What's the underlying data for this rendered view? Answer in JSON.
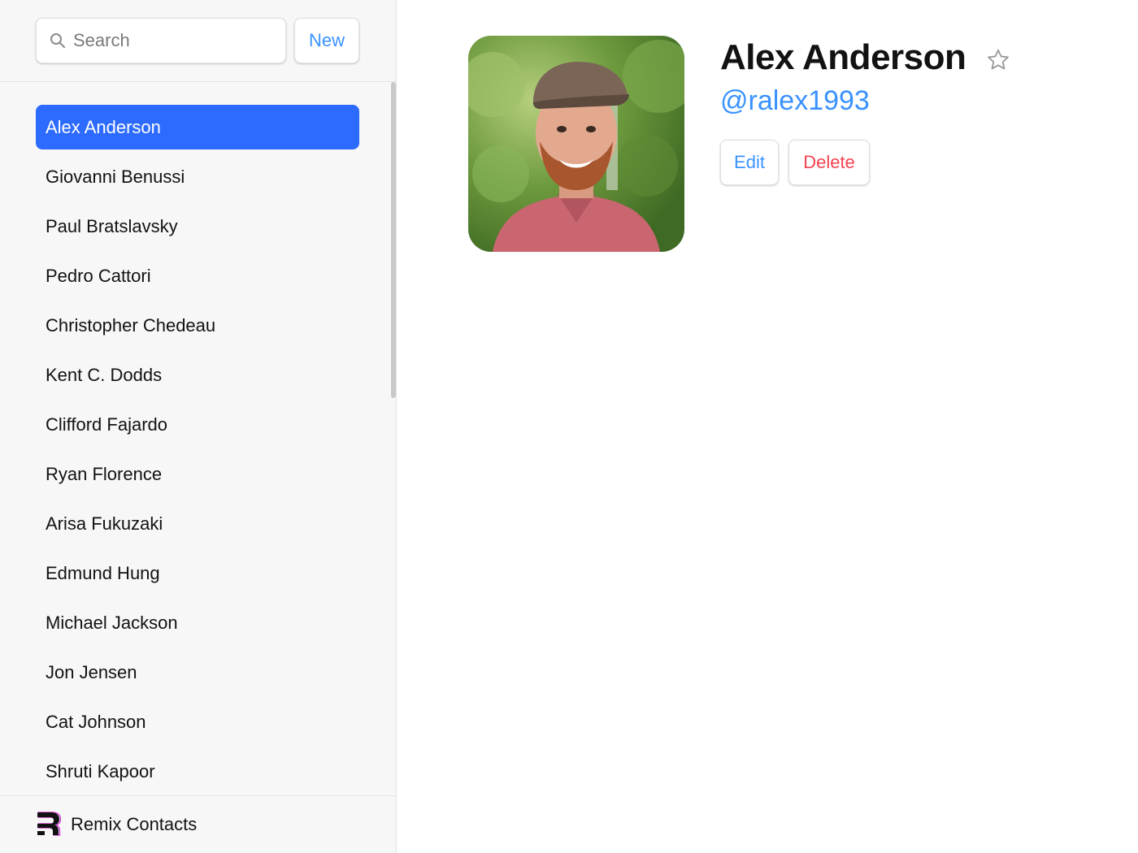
{
  "search": {
    "placeholder": "Search",
    "icon": "search-icon"
  },
  "new_button": {
    "label": "New"
  },
  "contacts": [
    {
      "name": "Alex Anderson",
      "active": true
    },
    {
      "name": "Giovanni Benussi"
    },
    {
      "name": "Paul Bratslavsky"
    },
    {
      "name": "Pedro Cattori"
    },
    {
      "name": "Christopher Chedeau"
    },
    {
      "name": "Kent C. Dodds"
    },
    {
      "name": "Clifford Fajardo"
    },
    {
      "name": "Ryan Florence"
    },
    {
      "name": "Arisa Fukuzaki"
    },
    {
      "name": "Edmund Hung"
    },
    {
      "name": "Michael Jackson"
    },
    {
      "name": "Jon Jensen"
    },
    {
      "name": "Cat Johnson"
    },
    {
      "name": "Shruti Kapoor"
    }
  ],
  "footer": {
    "title": "Remix Contacts",
    "logo": "remix-logo"
  },
  "detail": {
    "name": "Alex Anderson",
    "handle": "@ralex1993",
    "favorite": false,
    "edit_label": "Edit",
    "delete_label": "Delete"
  },
  "colors": {
    "accent": "#3992ff",
    "active_item": "#2d6bff",
    "danger": "#f44250",
    "sidebar_bg": "#f7f7f7"
  }
}
